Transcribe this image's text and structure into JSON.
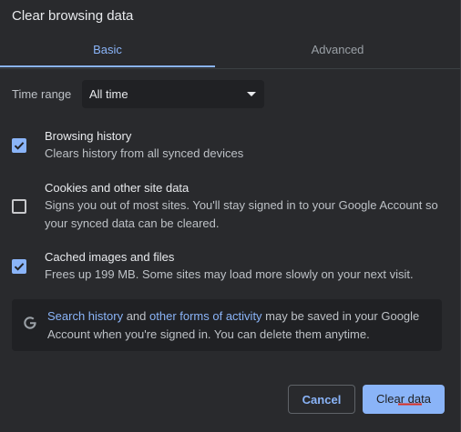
{
  "dialog": {
    "title": "Clear browsing data"
  },
  "tabs": [
    {
      "label": "Basic"
    },
    {
      "label": "Advanced"
    }
  ],
  "time_range": {
    "label": "Time range",
    "value": "All time"
  },
  "options": [
    {
      "title": "Browsing history",
      "description": "Clears history from all synced devices",
      "checked": true
    },
    {
      "title": "Cookies and other site data",
      "description": "Signs you out of most sites. You'll stay signed in to your Google Account so your synced data can be cleared.",
      "checked": false
    },
    {
      "title": "Cached images and files",
      "description": "Frees up 199 MB. Some sites may load more slowly on your next visit.",
      "checked": true
    }
  ],
  "info": {
    "link1": "Search history",
    "text1": " and ",
    "link2": "other forms of activity",
    "text2": " may be saved in your Google Account when you're signed in. You can delete them anytime."
  },
  "buttons": {
    "cancel": "Cancel",
    "clear": "Clear data"
  },
  "colors": {
    "accent": "#8ab4f8",
    "background": "#292a2d",
    "panel": "#202124",
    "text": "#e8eaed",
    "secondary_text": "#bdc1c6",
    "squiggle": "#d93025"
  },
  "icons": {
    "checkbox_checked": "check-icon",
    "info": "google-g-icon",
    "dropdown": "caret-down-icon"
  }
}
